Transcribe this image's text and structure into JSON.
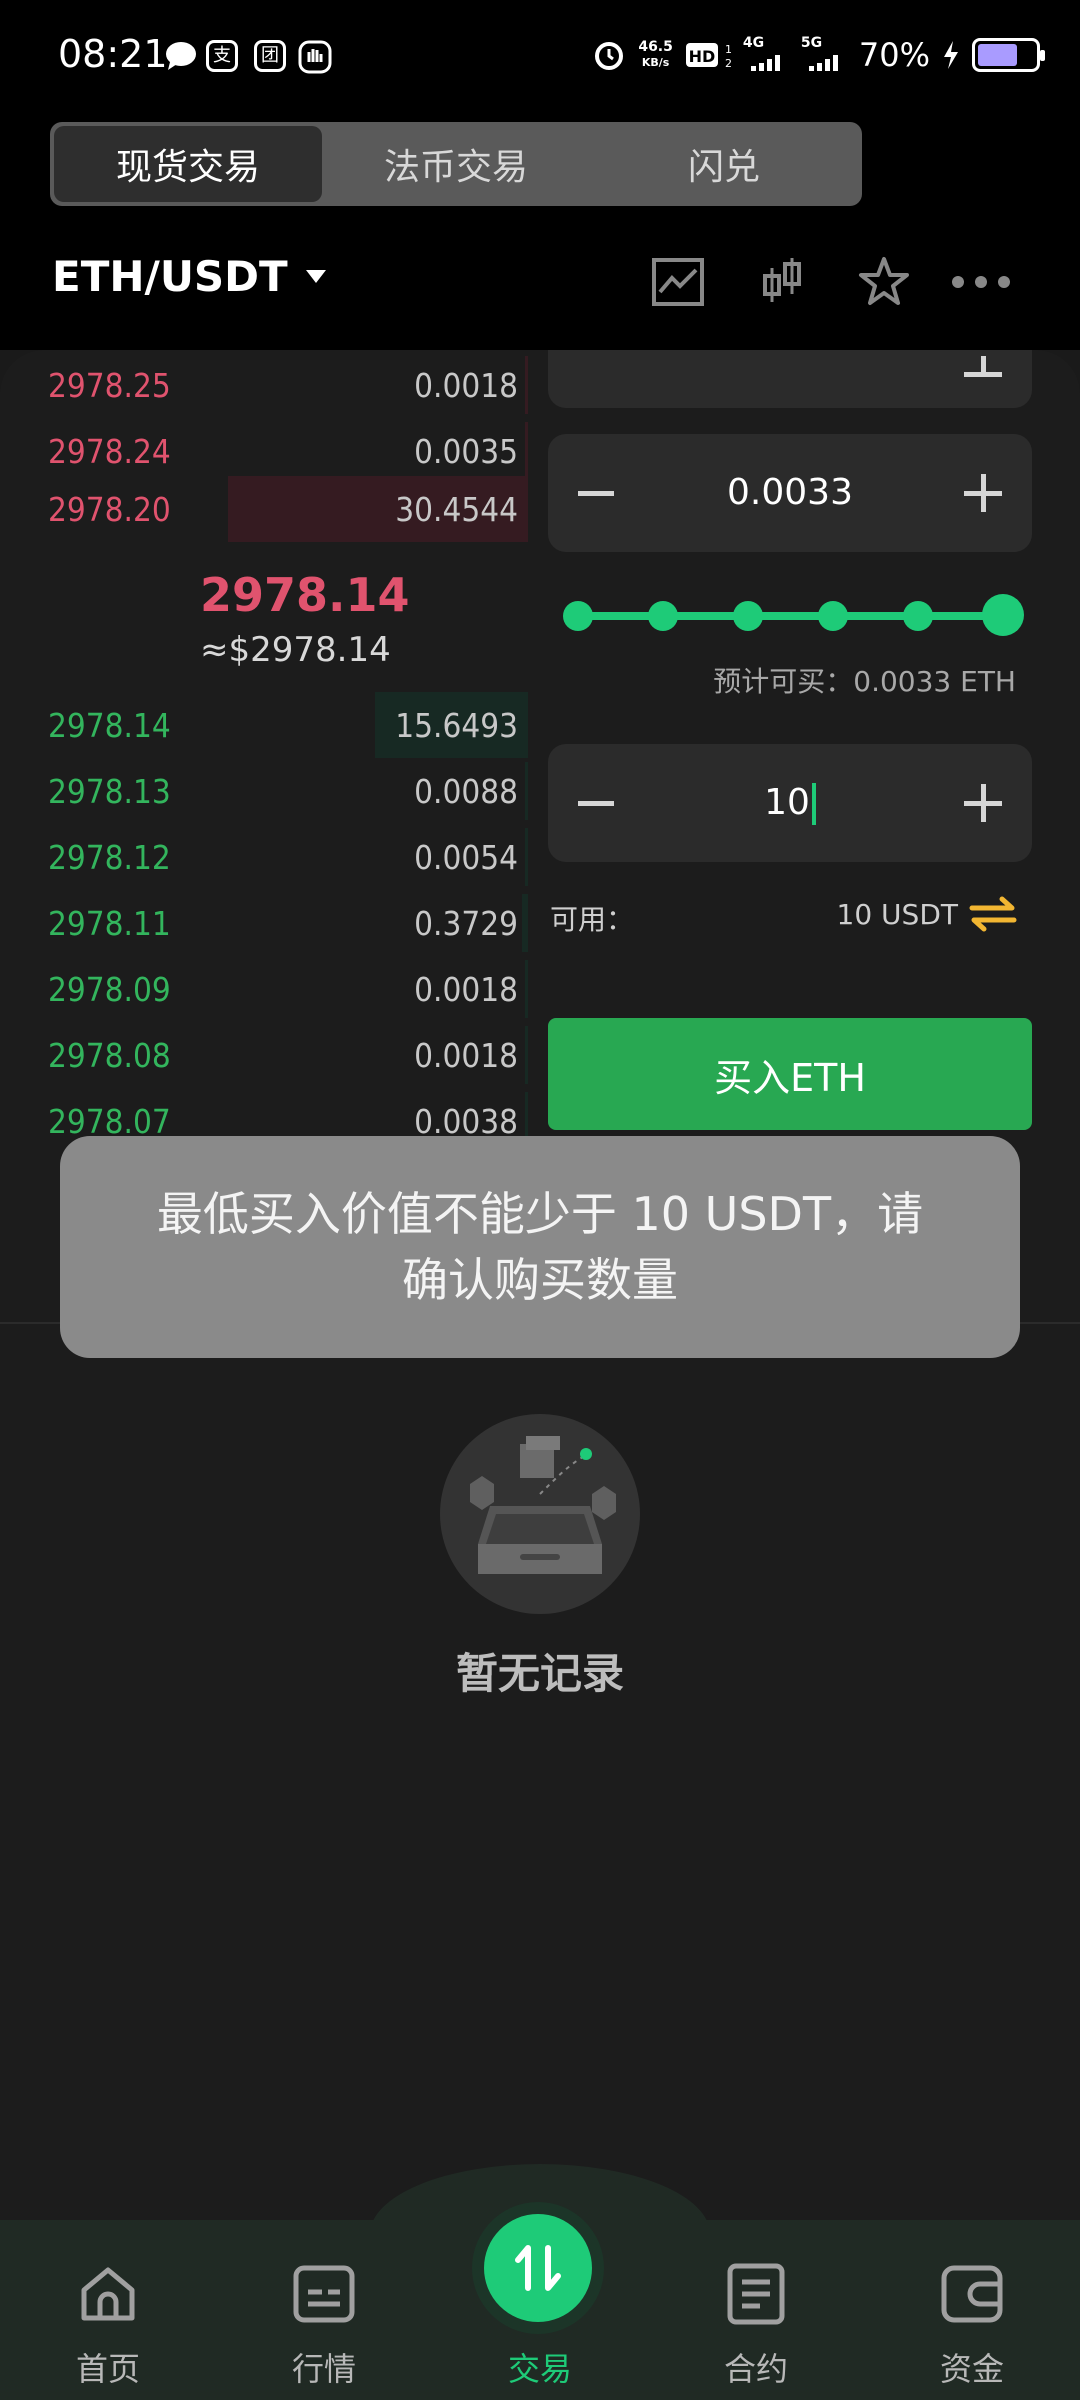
{
  "status": {
    "time": "08:21",
    "net_speed_top": "46.5",
    "net_speed_bottom": "KB/s",
    "battery": "70%"
  },
  "tabs": [
    "现货交易",
    "法币交易",
    "闪兑"
  ],
  "pair": "ETH/USDT",
  "orderbook": {
    "asks": [
      {
        "price": "2978.25",
        "qty": "0.0018",
        "depth": 0.01
      },
      {
        "price": "2978.24",
        "qty": "0.0035",
        "depth": 0.01
      },
      {
        "price": "2978.20",
        "qty": "30.4544",
        "depth": 1.0
      }
    ],
    "last_price": "2978.14",
    "last_price_fiat": "≈$2978.14",
    "bids": [
      {
        "price": "2978.14",
        "qty": "15.6493",
        "depth": 0.51
      },
      {
        "price": "2978.13",
        "qty": "0.0088",
        "depth": 0.01
      },
      {
        "price": "2978.12",
        "qty": "0.0054",
        "depth": 0.01
      },
      {
        "price": "2978.11",
        "qty": "0.3729",
        "depth": 0.02
      },
      {
        "price": "2978.09",
        "qty": "0.0018",
        "depth": 0.01
      },
      {
        "price": "2978.08",
        "qty": "0.0018",
        "depth": 0.01
      },
      {
        "price": "2978.07",
        "qty": "0.0038",
        "depth": 0.01
      }
    ]
  },
  "form": {
    "amount": "0.0033",
    "slider_fraction": 1.0,
    "estimate": "预计可买：0.0033  ETH",
    "total": "10",
    "available_label": "可用：",
    "available_value": "10  USDT",
    "buy_button": "买入ETH"
  },
  "toast": "最低买入价值不能少于 10 USDT，请确认购买数量",
  "empty_text": "暂无记录",
  "nav": [
    "首页",
    "行情",
    "交易",
    "合约",
    "资金"
  ],
  "colors": {
    "ask": "#e0536e",
    "bid": "#33b55d",
    "accent": "#1ecb78",
    "buy": "#28a852"
  }
}
